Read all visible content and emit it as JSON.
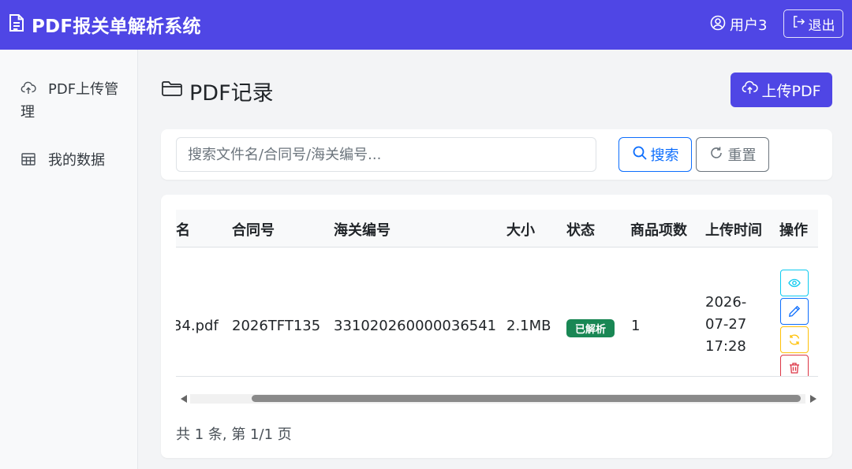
{
  "navbar": {
    "brand": "PDF报关单解析系统",
    "user": "用户3",
    "logout": "退出",
    "bg_color": "#4f46e5"
  },
  "sidebar": {
    "items": [
      {
        "label": "PDF上传管理",
        "icon": "cloud-upload-icon"
      },
      {
        "label": "我的数据",
        "icon": "table-icon"
      }
    ]
  },
  "main": {
    "title": "PDF记录",
    "upload_button": "上传PDF",
    "search": {
      "placeholder": "搜索文件名/合同号/海关编号...",
      "value": "",
      "search_button": "搜索",
      "reset_button": "重置"
    },
    "table": {
      "headers": [
        "名",
        "合同号",
        "海关编号",
        "大小",
        "状态",
        "商品项数",
        "上传时间",
        "操作"
      ],
      "rows": [
        {
          "filename": "34.pdf",
          "contract_no": "2026TFT135",
          "customs_no": "331020260000036541",
          "size": "2.1MB",
          "status": "已解析",
          "item_count": "1",
          "upload_time": "2026-07-27 17:28"
        }
      ],
      "actions": [
        "view-icon",
        "edit-icon",
        "reparse-icon",
        "delete-icon"
      ]
    },
    "pagination": "共 1 条, 第 1/1 页"
  },
  "colors": {
    "primary": "#4f46e5",
    "info": "#0dcaf0",
    "link": "#0d6efd",
    "warning": "#ffc107",
    "danger": "#dc3545",
    "success": "#198754"
  }
}
